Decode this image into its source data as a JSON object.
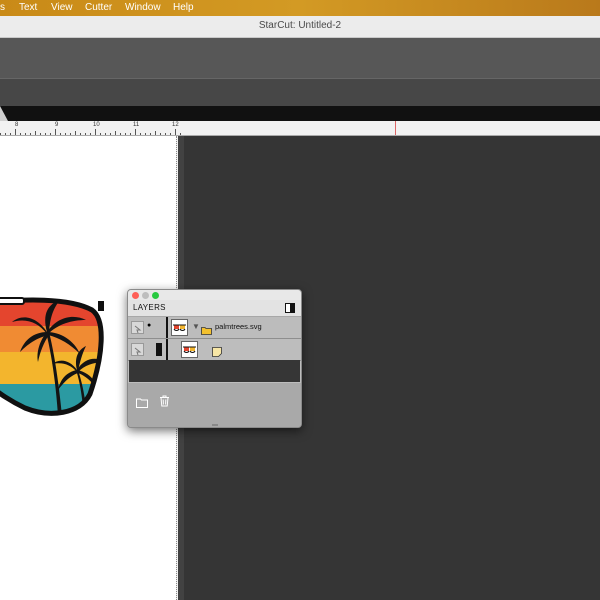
{
  "menubar": {
    "items": [
      "s",
      "Text",
      "View",
      "Cutter",
      "Window",
      "Help"
    ],
    "gradient_color": "#c98a17"
  },
  "window": {
    "title": "StarCut: Untitled-2"
  },
  "ruler": {
    "labels": [
      "8",
      "9",
      "10",
      "11",
      "12"
    ]
  },
  "layers_panel": {
    "title": "LAYERS",
    "rows": [
      {
        "name": "palmtrees.svg",
        "type": "group",
        "expanded": true
      },
      {
        "name": "",
        "type": "item"
      }
    ],
    "footer_icons": [
      "new-folder-icon",
      "trash-icon"
    ]
  },
  "colors": {
    "stripe_red": "#e4452e",
    "stripe_orange": "#f08b33",
    "stripe_yellow": "#f3b52d",
    "stripe_teal": "#2b9aa2",
    "folder": "#f3c12f"
  }
}
